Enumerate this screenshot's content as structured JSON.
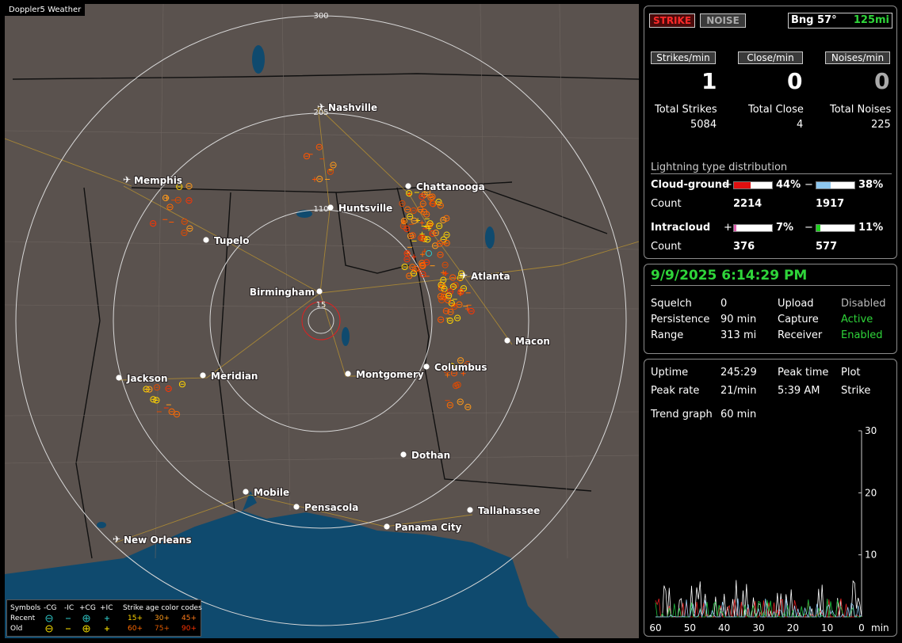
{
  "map": {
    "caption": "Doppler5 Weather",
    "ring_labels": [
      "300",
      "205",
      "110",
      "15"
    ],
    "cities": [
      {
        "name": "Nashville",
        "kind": "airport"
      },
      {
        "name": "Memphis",
        "kind": "airport"
      },
      {
        "name": "Chattanooga",
        "kind": "city"
      },
      {
        "name": "Huntsville",
        "kind": "city"
      },
      {
        "name": "Tupelo",
        "kind": "city"
      },
      {
        "name": "Atlanta",
        "kind": "airport"
      },
      {
        "name": "Birmingham",
        "kind": "city"
      },
      {
        "name": "Macon",
        "kind": "city"
      },
      {
        "name": "Jackson",
        "kind": "city"
      },
      {
        "name": "Meridian",
        "kind": "city"
      },
      {
        "name": "Montgomery",
        "kind": "city"
      },
      {
        "name": "Columbus",
        "kind": "city"
      },
      {
        "name": "Dothan",
        "kind": "city"
      },
      {
        "name": "Mobile",
        "kind": "city"
      },
      {
        "name": "Pensacola",
        "kind": "city"
      },
      {
        "name": "Tallahassee",
        "kind": "city"
      },
      {
        "name": "Panama City",
        "kind": "city"
      },
      {
        "name": "New Orleans",
        "kind": "airport"
      }
    ],
    "legend": {
      "symbols_label": "Symbols",
      "headers": [
        "-CG",
        "-IC",
        "+CG",
        "+IC"
      ],
      "recent_label": "Recent",
      "old_label": "Old",
      "age_title": "Strike age color codes",
      "recent_ages": [
        "15+",
        "30+",
        "45+"
      ],
      "old_ages": [
        "60+",
        "75+",
        "90+"
      ],
      "age_colors": [
        "#ffd400",
        "#ff9a1a",
        "#ff6a00",
        "#ff5500",
        "#e04a00",
        "#ff3300"
      ]
    }
  },
  "top": {
    "strike_btn": "STRIKE",
    "noise_btn": "NOISE",
    "bearing": "Bng 57°",
    "range": "125mi",
    "strikes_min_label": "Strikes/min",
    "close_min_label": "Close/min",
    "noises_min_label": "Noises/min",
    "strikes_min": "1",
    "close_min": "0",
    "noises_min": "0",
    "total_strikes_label": "Total Strikes",
    "total_close_label": "Total Close",
    "total_noises_label": "Total Noises",
    "total_strikes": "5084",
    "total_close": "4",
    "total_noises": "225",
    "dist_title": "Lightning type distribution",
    "cg_label": "Cloud-ground",
    "ic_label": "Intracloud",
    "count_label": "Count",
    "plus": "+",
    "minus": "−",
    "cg_pos_pct": "44%",
    "cg_neg_pct": "38%",
    "cg_pos_count": "2214",
    "cg_neg_count": "1917",
    "ic_pos_pct": "7%",
    "ic_neg_pct": "11%",
    "ic_pos_count": "376",
    "ic_neg_count": "577",
    "cg_pos_frac": 0.44,
    "cg_neg_frac": 0.38,
    "ic_pos_frac": 0.07,
    "ic_neg_frac": 0.11,
    "colors": {
      "cg_pos": "#e01010",
      "cg_neg": "#8ec8f0",
      "ic_pos": "#e060b0",
      "ic_neg": "#20d020"
    }
  },
  "mid": {
    "datetime": "9/9/2025 6:14:29 PM",
    "squelch_label": "Squelch",
    "squelch": "0",
    "persistence_label": "Persistence",
    "persistence": "90 min",
    "range_label": "Range",
    "range": "313 mi",
    "upload_label": "Upload",
    "upload": "Disabled",
    "capture_label": "Capture",
    "capture": "Active",
    "receiver_label": "Receiver",
    "receiver": "Enabled"
  },
  "bottom": {
    "uptime_label": "Uptime",
    "uptime": "245:29",
    "peak_time_label": "Peak time",
    "peak_time": "5:39 AM",
    "plot_label": "Plot",
    "plot": "Strike",
    "peak_rate_label": "Peak rate",
    "peak_rate": "21/min",
    "trend_label": "Trend graph",
    "trend": "60 min"
  },
  "chart_data": {
    "type": "line",
    "x_ticks": [
      "60",
      "50",
      "40",
      "30",
      "20",
      "10",
      "0"
    ],
    "x_unit": "min",
    "y_ticks": [
      "30",
      "20",
      "10"
    ],
    "ylim": [
      0,
      30
    ],
    "xlim": [
      60,
      0
    ]
  }
}
